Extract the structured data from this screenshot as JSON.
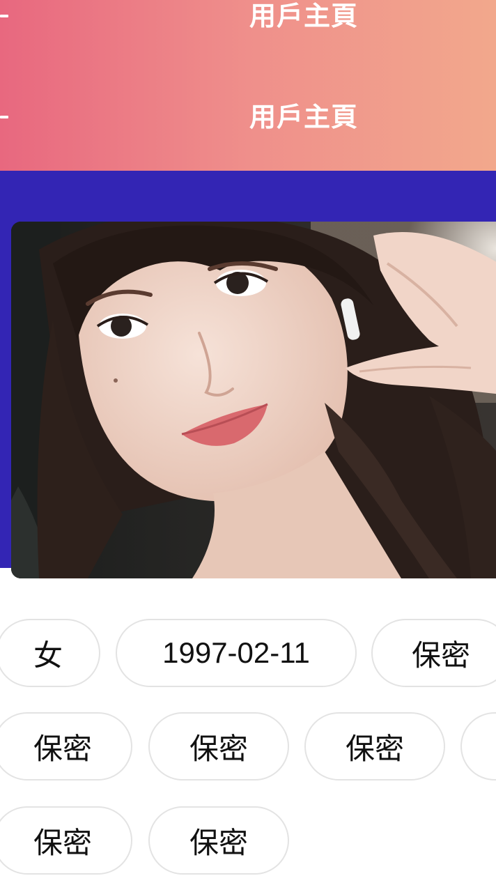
{
  "header": {
    "title": "用戶主頁",
    "title_repeat": "用戶主頁"
  },
  "profile_photo": {
    "alt": "profile photo"
  },
  "tags": {
    "row1": [
      "女",
      "1997-02-11",
      "保密"
    ],
    "row2": [
      "保密",
      "保密",
      "保密",
      ""
    ],
    "row3": [
      "保密",
      "保密"
    ]
  },
  "colors": {
    "header_gradient_start": "#e8687f",
    "header_gradient_end": "#f2a88c",
    "banner": "#3325b4",
    "tag_border": "#e3e3e3"
  }
}
